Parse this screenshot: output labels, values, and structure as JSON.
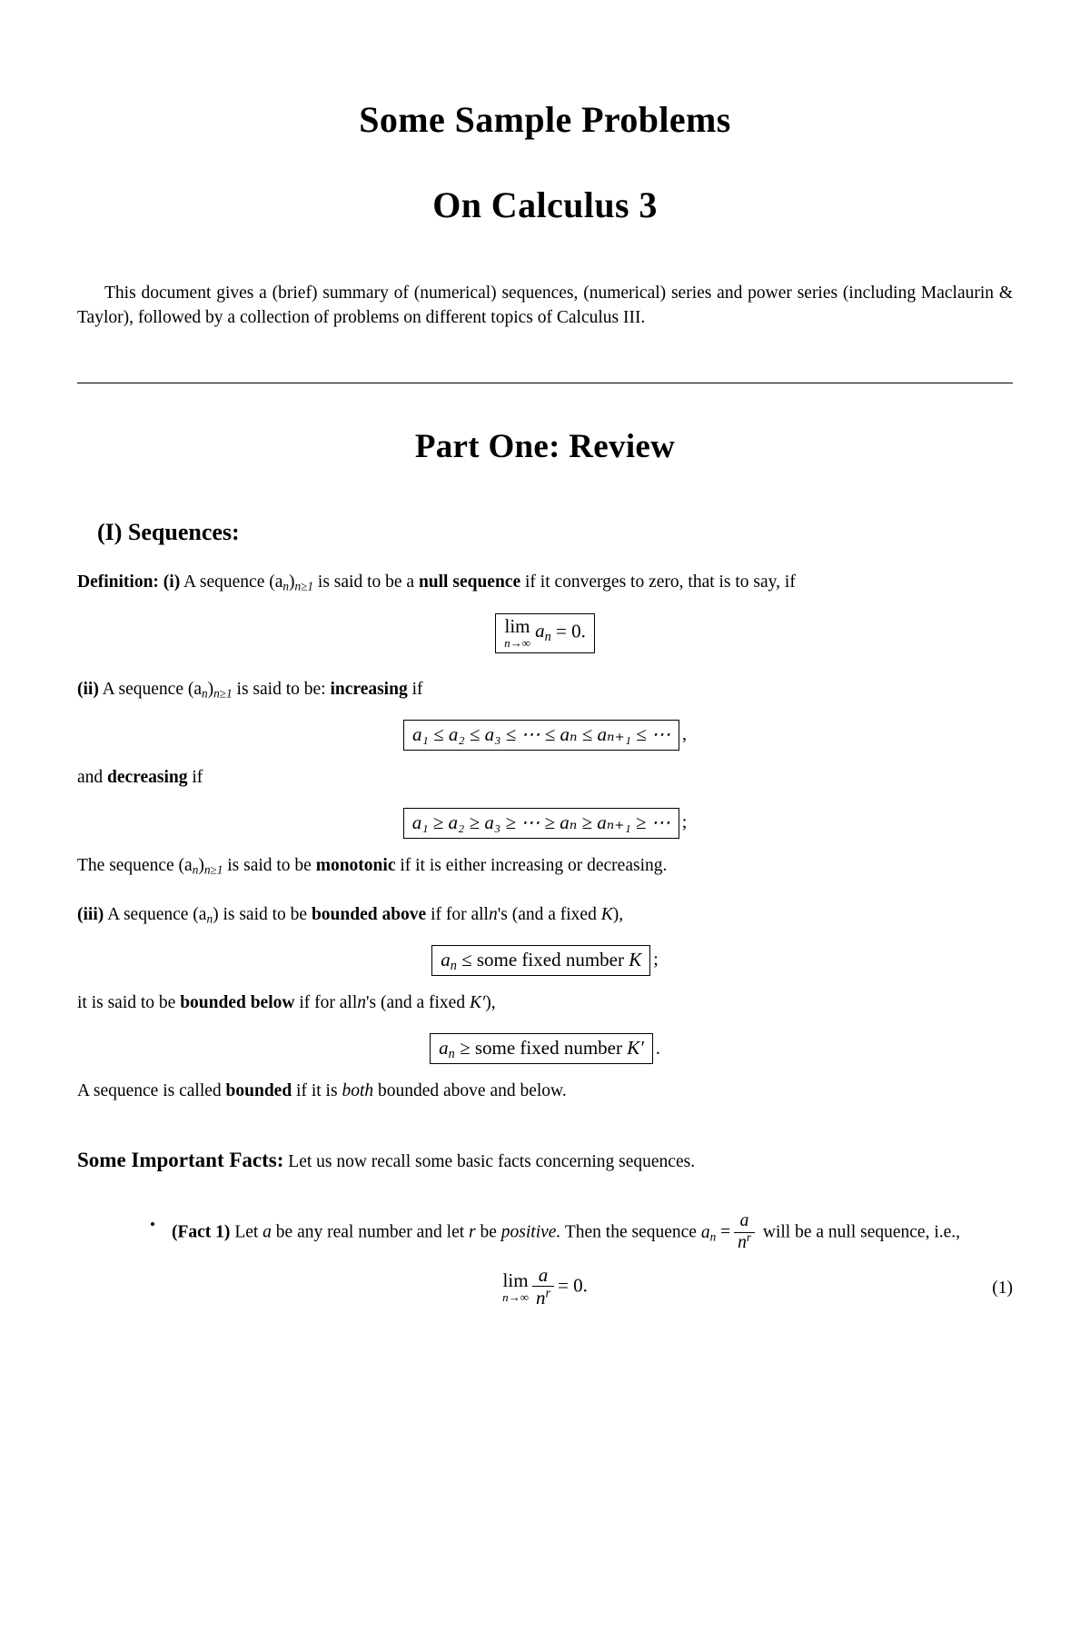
{
  "document": {
    "title_line1": "Some Sample Problems",
    "title_line2": "On Calculus 3",
    "intro": "This document gives a (brief) summary of (numerical) sequences, (numerical) series and power series (including Maclaurin & Taylor), followed by a collection of problems on different topics of Calculus III.",
    "part_title": "Part One:  Review",
    "section_head": "(I) Sequences:"
  },
  "definition": {
    "label": "Definition:",
    "item_i_marker": "(i)",
    "item_i_text_a": "A sequence",
    "item_i_seq": "(a",
    "item_i_seq_sub": "n",
    "item_i_seq_close": ")",
    "item_i_seq_cond": "n≥1",
    "item_i_text_b": "is said to be a",
    "item_i_bold": "null sequence",
    "item_i_text_c": "if it converges to zero, that is to say, if",
    "formula_null": {
      "lim_op": "lim",
      "lim_sub": "n→∞",
      "body": "a",
      "body_sub": "n",
      "rest": "= 0."
    },
    "item_ii_marker": "(ii)",
    "item_ii_text_a": "A sequence",
    "item_ii_text_b": "is said to be:",
    "item_ii_bold": "increasing",
    "item_ii_text_c": "if",
    "formula_increasing": "a₁ ≤ a₂ ≤ a₃ ≤ ⋯ ≤ aₙ ≤ aₙ₊₁ ≤ ⋯",
    "formula_increasing_trail": ",",
    "item_ii_text_d": "and",
    "item_ii_bold2": "decreasing",
    "item_ii_text_e": "if",
    "formula_decreasing": "a₁ ≥ a₂ ≥ a₃ ≥ ⋯ ≥ aₙ ≥ aₙ₊₁ ≥ ⋯",
    "formula_decreasing_trail": ";",
    "monotonic_text_a": "The sequence",
    "monotonic_text_b": "is said to be",
    "monotonic_bold": "monotonic",
    "monotonic_text_c": "if it is either increasing or decreasing.",
    "item_iii_marker": "(iii)",
    "item_iii_text_a": "A sequence",
    "item_iii_seq": "(a",
    "item_iii_seq_sub": "n",
    "item_iii_seq_close": ")",
    "item_iii_text_b": "is said to be",
    "item_iii_bold": "bounded above",
    "item_iii_text_c": "if for all",
    "item_iii_n": "n",
    "item_iii_text_d": "'s (and a fixed",
    "item_iii_K": "K",
    "item_iii_text_e": "),",
    "formula_above_lhs": "a",
    "formula_above_lhs_sub": "n",
    "formula_above_rest": "≤ some fixed number",
    "formula_above_K": "K",
    "formula_above_trail": ";",
    "below_text_a": "it is said to be",
    "below_bold": "bounded below",
    "below_text_b": "if for all",
    "below_n": "n",
    "below_text_c": "'s (and a fixed",
    "below_K": "K′",
    "below_text_d": "),",
    "formula_below_lhs": "a",
    "formula_below_lhs_sub": "n",
    "formula_below_rest": "≥ some fixed number",
    "formula_below_K": "K′",
    "formula_below_trail": ".",
    "bounded_text_a": "A sequence is called",
    "bounded_bold": "bounded",
    "bounded_text_b": "if it is",
    "bounded_italic": "both",
    "bounded_text_c": "bounded above and below."
  },
  "facts": {
    "heading_bold": "Some Important Facts:",
    "heading_rest": "Let us now recall some basic facts concerning sequences.",
    "bullet_glyph": "•",
    "items": [
      {
        "label": "(Fact 1)",
        "text_a": "Let",
        "var_a": "a",
        "text_b": "be any real number and let",
        "var_r": "r",
        "text_c": "be",
        "italic_positive": "positive.",
        "text_d": "Then the sequence",
        "seq_lhs": "a",
        "seq_lhs_sub": "n",
        "eq_sign": "=",
        "frac_num": "a",
        "frac_den": "n",
        "frac_den_sup": "r",
        "text_e": "will be a null sequence, i.e.,",
        "equation": {
          "lim_op": "lim",
          "lim_sub": "n→∞",
          "frac_num": "a",
          "frac_den": "n",
          "frac_den_sup": "r",
          "rest": "= 0.",
          "tag": "(1)"
        }
      }
    ]
  }
}
